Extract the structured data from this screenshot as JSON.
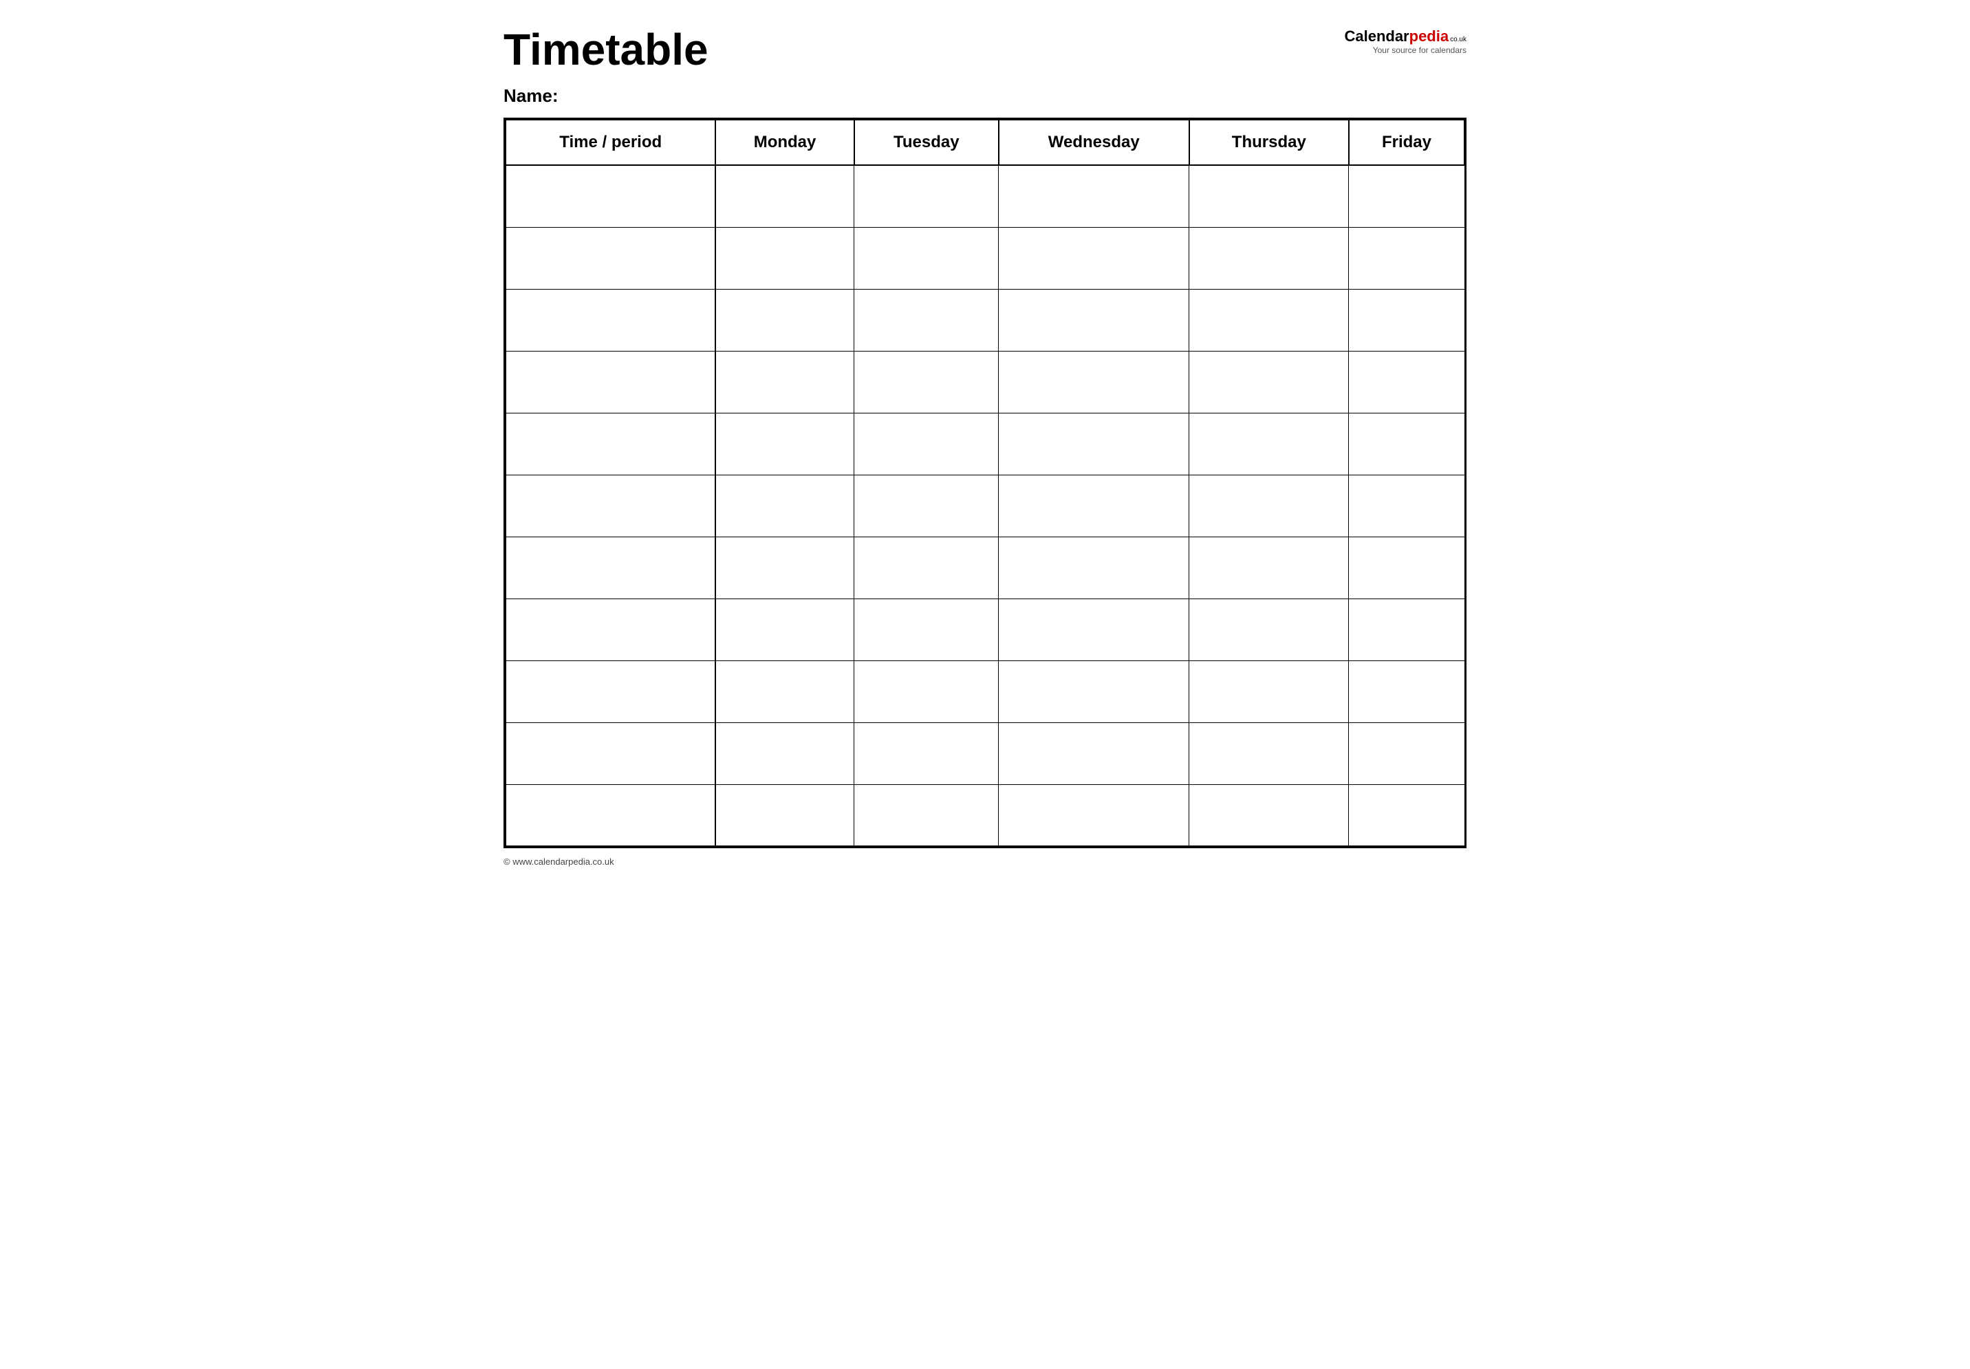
{
  "title": "Timetable",
  "name_label": "Name:",
  "logo": {
    "calendar_text": "Calendar",
    "pedia_text": "pedia",
    "tld": "co.uk",
    "tagline": "Your source for calendars"
  },
  "table": {
    "headers": [
      "Time / period",
      "Monday",
      "Tuesday",
      "Wednesday",
      "Thursday",
      "Friday"
    ],
    "row_count": 11
  },
  "footer": {
    "url": "www.calendarpedia.co.uk"
  }
}
